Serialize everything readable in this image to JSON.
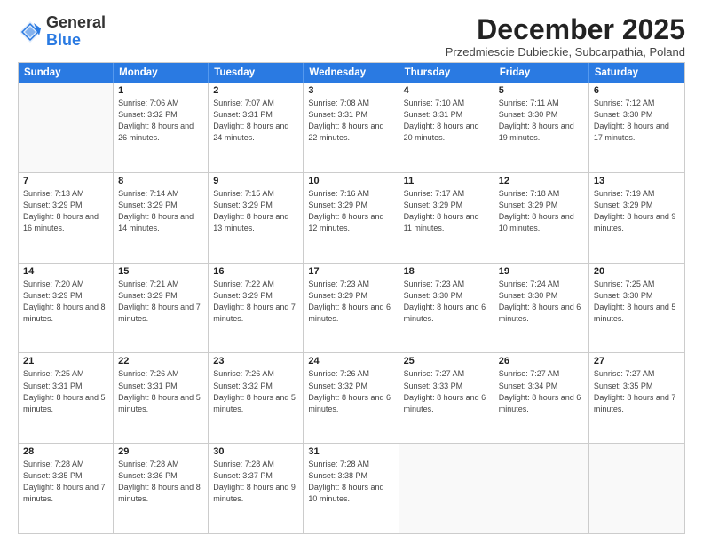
{
  "logo": {
    "general": "General",
    "blue": "Blue"
  },
  "title": "December 2025",
  "location": "Przedmiescie Dubieckie, Subcarpathia, Poland",
  "days_header": [
    "Sunday",
    "Monday",
    "Tuesday",
    "Wednesday",
    "Thursday",
    "Friday",
    "Saturday"
  ],
  "weeks": [
    [
      {
        "day": "",
        "empty": true
      },
      {
        "day": "1",
        "sunrise": "7:06 AM",
        "sunset": "3:32 PM",
        "daylight": "8 hours and 26 minutes."
      },
      {
        "day": "2",
        "sunrise": "7:07 AM",
        "sunset": "3:31 PM",
        "daylight": "8 hours and 24 minutes."
      },
      {
        "day": "3",
        "sunrise": "7:08 AM",
        "sunset": "3:31 PM",
        "daylight": "8 hours and 22 minutes."
      },
      {
        "day": "4",
        "sunrise": "7:10 AM",
        "sunset": "3:31 PM",
        "daylight": "8 hours and 20 minutes."
      },
      {
        "day": "5",
        "sunrise": "7:11 AM",
        "sunset": "3:30 PM",
        "daylight": "8 hours and 19 minutes."
      },
      {
        "day": "6",
        "sunrise": "7:12 AM",
        "sunset": "3:30 PM",
        "daylight": "8 hours and 17 minutes."
      }
    ],
    [
      {
        "day": "7",
        "sunrise": "7:13 AM",
        "sunset": "3:29 PM",
        "daylight": "8 hours and 16 minutes."
      },
      {
        "day": "8",
        "sunrise": "7:14 AM",
        "sunset": "3:29 PM",
        "daylight": "8 hours and 14 minutes."
      },
      {
        "day": "9",
        "sunrise": "7:15 AM",
        "sunset": "3:29 PM",
        "daylight": "8 hours and 13 minutes."
      },
      {
        "day": "10",
        "sunrise": "7:16 AM",
        "sunset": "3:29 PM",
        "daylight": "8 hours and 12 minutes."
      },
      {
        "day": "11",
        "sunrise": "7:17 AM",
        "sunset": "3:29 PM",
        "daylight": "8 hours and 11 minutes."
      },
      {
        "day": "12",
        "sunrise": "7:18 AM",
        "sunset": "3:29 PM",
        "daylight": "8 hours and 10 minutes."
      },
      {
        "day": "13",
        "sunrise": "7:19 AM",
        "sunset": "3:29 PM",
        "daylight": "8 hours and 9 minutes."
      }
    ],
    [
      {
        "day": "14",
        "sunrise": "7:20 AM",
        "sunset": "3:29 PM",
        "daylight": "8 hours and 8 minutes."
      },
      {
        "day": "15",
        "sunrise": "7:21 AM",
        "sunset": "3:29 PM",
        "daylight": "8 hours and 7 minutes."
      },
      {
        "day": "16",
        "sunrise": "7:22 AM",
        "sunset": "3:29 PM",
        "daylight": "8 hours and 7 minutes."
      },
      {
        "day": "17",
        "sunrise": "7:23 AM",
        "sunset": "3:29 PM",
        "daylight": "8 hours and 6 minutes."
      },
      {
        "day": "18",
        "sunrise": "7:23 AM",
        "sunset": "3:30 PM",
        "daylight": "8 hours and 6 minutes."
      },
      {
        "day": "19",
        "sunrise": "7:24 AM",
        "sunset": "3:30 PM",
        "daylight": "8 hours and 6 minutes."
      },
      {
        "day": "20",
        "sunrise": "7:25 AM",
        "sunset": "3:30 PM",
        "daylight": "8 hours and 5 minutes."
      }
    ],
    [
      {
        "day": "21",
        "sunrise": "7:25 AM",
        "sunset": "3:31 PM",
        "daylight": "8 hours and 5 minutes."
      },
      {
        "day": "22",
        "sunrise": "7:26 AM",
        "sunset": "3:31 PM",
        "daylight": "8 hours and 5 minutes."
      },
      {
        "day": "23",
        "sunrise": "7:26 AM",
        "sunset": "3:32 PM",
        "daylight": "8 hours and 5 minutes."
      },
      {
        "day": "24",
        "sunrise": "7:26 AM",
        "sunset": "3:32 PM",
        "daylight": "8 hours and 6 minutes."
      },
      {
        "day": "25",
        "sunrise": "7:27 AM",
        "sunset": "3:33 PM",
        "daylight": "8 hours and 6 minutes."
      },
      {
        "day": "26",
        "sunrise": "7:27 AM",
        "sunset": "3:34 PM",
        "daylight": "8 hours and 6 minutes."
      },
      {
        "day": "27",
        "sunrise": "7:27 AM",
        "sunset": "3:35 PM",
        "daylight": "8 hours and 7 minutes."
      }
    ],
    [
      {
        "day": "28",
        "sunrise": "7:28 AM",
        "sunset": "3:35 PM",
        "daylight": "8 hours and 7 minutes."
      },
      {
        "day": "29",
        "sunrise": "7:28 AM",
        "sunset": "3:36 PM",
        "daylight": "8 hours and 8 minutes."
      },
      {
        "day": "30",
        "sunrise": "7:28 AM",
        "sunset": "3:37 PM",
        "daylight": "8 hours and 9 minutes."
      },
      {
        "day": "31",
        "sunrise": "7:28 AM",
        "sunset": "3:38 PM",
        "daylight": "8 hours and 10 minutes."
      },
      {
        "day": "",
        "empty": true
      },
      {
        "day": "",
        "empty": true
      },
      {
        "day": "",
        "empty": true
      }
    ]
  ]
}
